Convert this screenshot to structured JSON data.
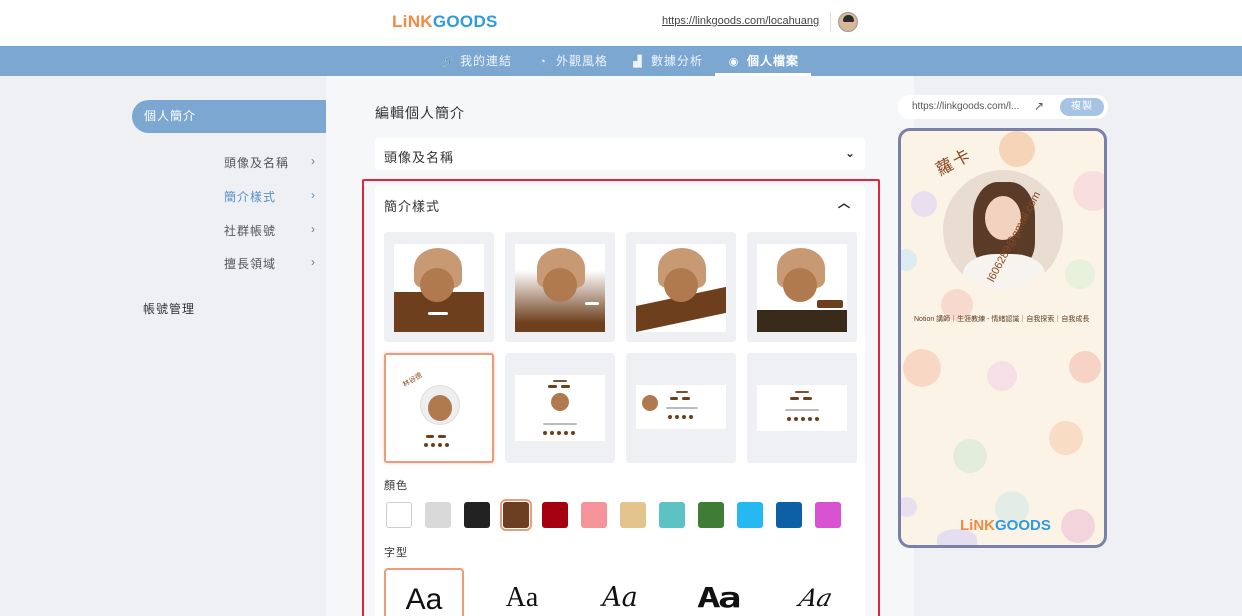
{
  "header": {
    "logo_part1": "LiNK",
    "logo_part2": "GOODS",
    "url": "https://linkgoods.com/locahuang"
  },
  "nav": {
    "items": [
      {
        "label": "我的連結",
        "icon": "link-icon"
      },
      {
        "label": "外觀風格",
        "icon": "palette-icon"
      },
      {
        "label": "數據分析",
        "icon": "bar-chart-icon"
      },
      {
        "label": "個人檔案",
        "icon": "user-circle-icon",
        "active": true
      }
    ]
  },
  "sidebar": {
    "active_section": "個人簡介",
    "sub_items": [
      {
        "label": "頭像及名稱"
      },
      {
        "label": "簡介樣式",
        "active": true
      },
      {
        "label": "社群帳號"
      },
      {
        "label": "擅長領域"
      }
    ],
    "account": "帳號管理"
  },
  "main": {
    "title": "編輯個人簡介",
    "accordion_closed": "頭像及名稱",
    "panel_title": "簡介樣式",
    "templates_selected_index": 4,
    "template_name_label": "林谷德",
    "color_label": "顏色",
    "colors": [
      "#ffffff",
      "#d9d9d9",
      "#222222",
      "#6b3f1f",
      "#a40010",
      "#f5939a",
      "#e2c48c",
      "#5cc2c3",
      "#3f7d36",
      "#25b8f1",
      "#0d5fa6",
      "#d852d1"
    ],
    "color_selected_index": 3,
    "font_label": "字型",
    "fonts": [
      "Aa",
      "Aa",
      "Aa",
      "Aa",
      "Aa"
    ],
    "font_selected_index": 0
  },
  "preview": {
    "url": "https://linkgoods.com/l...",
    "copy_label": "複製",
    "name": "蘿卡",
    "email": "l606289@gmail.com",
    "bio": "Notion 講師｜生涯教練 - 情緒認識｜自我探索｜自我成長",
    "logo_part1": "LiNK",
    "logo_part2": "GOODS"
  }
}
